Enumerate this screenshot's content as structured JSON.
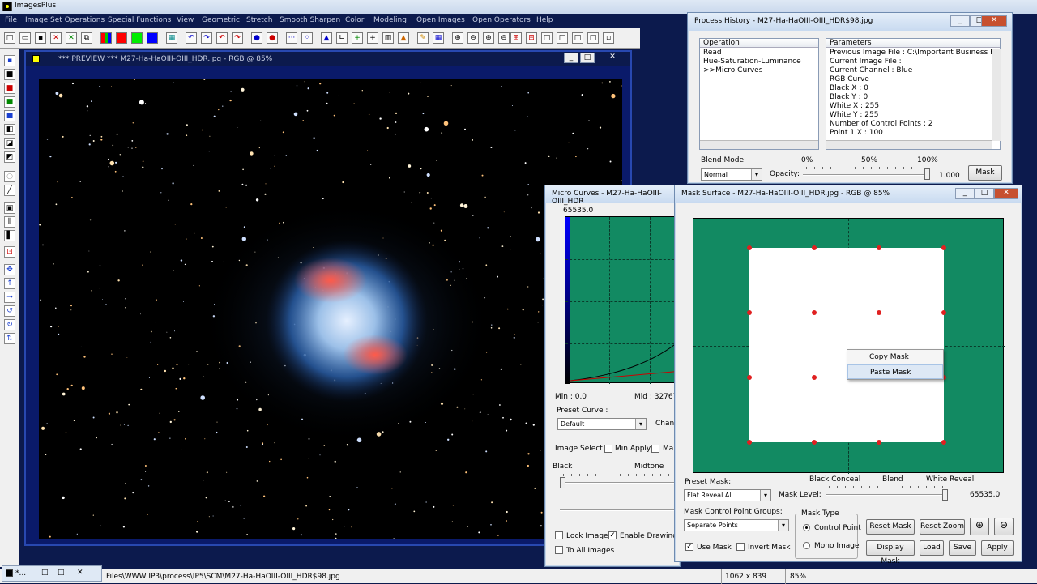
{
  "app": {
    "title": "ImagesPlus"
  },
  "menu": [
    "File",
    "Image Set Operations",
    "Special Functions",
    "View",
    "Geometric",
    "Stretch",
    "Smooth Sharpen",
    "Color",
    "Modeling",
    "Open Images",
    "Open Operators",
    "Help"
  ],
  "preview": {
    "title": "*** PREVIEW *** M27-Ha-HaOIII-OIII_HDR.jpg - RGB @ 85%"
  },
  "history": {
    "title": "Process History - M27-Ha-HaOIII-OIII_HDR$98.jpg",
    "op_header": "Operation",
    "param_header": "Parameters",
    "operations": [
      "Read",
      "Hue-Saturation-Luminance",
      ">>Micro Curves"
    ],
    "parameters": [
      "Previous Image File : C:\\Important Business Files\\W\\",
      "Current Image File :",
      "Current Channel : Blue",
      "RGB Curve",
      " Black X : 0",
      " Black Y : 0",
      " White X : 255",
      " White Y : 255",
      " Number of Control Points : 2",
      "  Point 1 X : 100"
    ],
    "blend_label": "Blend Mode:",
    "blend_value": "Normal",
    "opacity_label": "Opacity:",
    "pct0": "0%",
    "pct50": "50%",
    "pct100": "100%",
    "opacity_value": "1.000",
    "mask_btn": "Mask"
  },
  "micro": {
    "title": "Micro Curves - M27-Ha-HaOIII-OIII_HDR",
    "top_value": "65535.0",
    "min": "Min : 0.0",
    "mid": "Mid : 32767.",
    "preset_label": "Preset Curve :",
    "preset_value": "Default",
    "channel_cut": "Chann",
    "image_select": "Image Select",
    "min_apply": "Min Apply",
    "max_cut": "Ma",
    "black": "Black",
    "midtone": "Midtone",
    "lock_image": "Lock Image",
    "enable_drawing": "Enable Drawing",
    "to_all": "To All Images"
  },
  "mask": {
    "title": "Mask Surface - M27-Ha-HaOIII-OIII_HDR.jpg - RGB @ 85%",
    "preset_label": "Preset Mask:",
    "preset_value": "Flat Reveal All",
    "black_conceal": "Black Conceal",
    "blend": "Blend",
    "white_reveal": "White Reveal",
    "mask_level_label": "Mask Level:",
    "mask_level_value": "65535.0",
    "groups_label": "Mask Control Point Groups:",
    "groups_value": "Separate Points",
    "mask_type_label": "Mask Type",
    "control_point": "Control Point",
    "mono_image": "Mono Image",
    "use_mask": "Use Mask",
    "invert_mask": "Invert Mask",
    "reset_mask": "Reset Mask",
    "reset_zoom": "Reset Zoom",
    "display_mask": "Display Mask",
    "load": "Load",
    "save": "Save",
    "apply": "Apply",
    "context_menu": [
      "Copy Mask",
      "Paste Mask"
    ]
  },
  "status": {
    "path": "Files\\WWW IP3\\process\\IP5\\SCM\\M27-Ha-HaOIII-OIII_HDR$98.jpg",
    "dims": "1062 x 839",
    "zoom": "85%",
    "task_title": "*..."
  },
  "colors": {
    "mask_green": "#128a62",
    "desktop": "#0c1a4d",
    "red_points": "#e02020"
  }
}
